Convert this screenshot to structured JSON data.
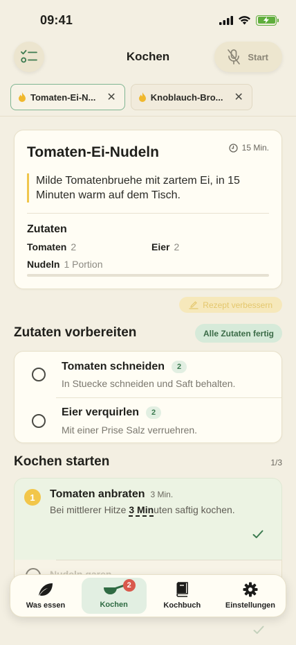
{
  "status": {
    "time": "09:41"
  },
  "header": {
    "title": "Kochen",
    "start_label": "Start"
  },
  "tabs": [
    {
      "label": "Tomaten-Ei-N...",
      "active": true
    },
    {
      "label": "Knoblauch-Bro...",
      "active": false
    }
  ],
  "recipe": {
    "title": "Tomaten-Ei-Nudeln",
    "time": "15 Min.",
    "description": "Milde Tomatenbruehe mit zartem Ei, in 15 Minuten warm auf dem Tisch.",
    "ingredients_title": "Zutaten",
    "ingredients": [
      {
        "name": "Tomaten",
        "qty": "2"
      },
      {
        "name": "Eier",
        "qty": "2"
      },
      {
        "name": "Nudeln",
        "qty": "1 Portion"
      }
    ]
  },
  "improve_label": "Rezept verbessern",
  "prep": {
    "title": "Zutaten vorbereiten",
    "all_done_label": "Alle Zutaten fertig",
    "items": [
      {
        "name": "Tomaten schneiden",
        "count": "2",
        "desc": "In Stuecke schneiden und Saft behalten."
      },
      {
        "name": "Eier verquirlen",
        "count": "2",
        "desc": "Mit einer Prise Salz verruehren."
      }
    ]
  },
  "cooking": {
    "title": "Kochen starten",
    "counter": "1/3",
    "step": {
      "number": "1",
      "title": "Tomaten anbraten",
      "duration": "3 Min.",
      "desc_before": "Bei mittlerer Hitze ",
      "desc_highlight": "3 Min",
      "desc_after": "uten saftig kochen."
    },
    "next_step_title": "Nudeln garen"
  },
  "tabbar": {
    "items": [
      {
        "label": "Was essen",
        "icon": "leaf-icon"
      },
      {
        "label": "Kochen",
        "icon": "pan-icon",
        "badge": "2",
        "active": true
      },
      {
        "label": "Kochbuch",
        "icon": "book-icon"
      },
      {
        "label": "Einstellungen",
        "icon": "gear-icon"
      }
    ]
  },
  "colors": {
    "accent_green": "#3b7a4f",
    "accent_yellow": "#f2c64a",
    "badge_red": "#d9594c",
    "background": "#f3efe2"
  }
}
